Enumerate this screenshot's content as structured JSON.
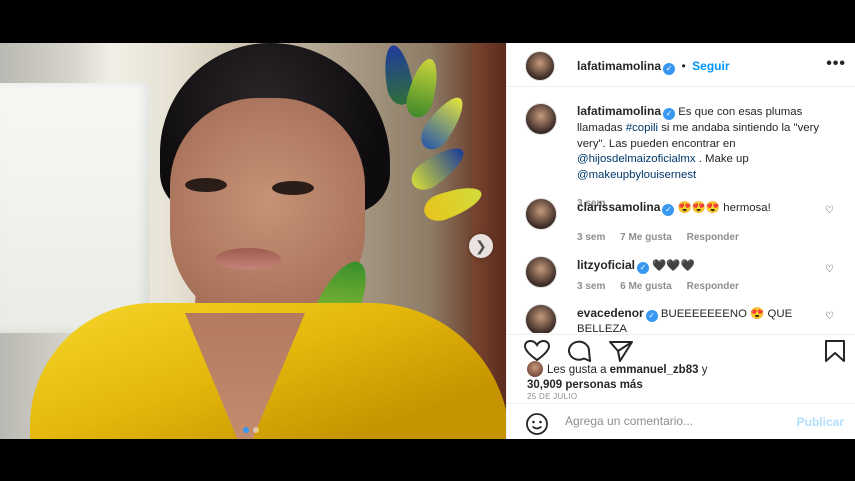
{
  "post": {
    "author": "lafatimamolina",
    "follow_label": "Seguir",
    "more_label": "•••",
    "caption": {
      "username": "lafatimamolina",
      "text_1": "Es que con esas plumas llamadas ",
      "hashtag": "#copili",
      "text_2": " si me andaba sintiendo la \"very very\". Las pueden encontrar en ",
      "mention_1": "@hijosdelmaizoficialmx",
      "text_3": " . Make up ",
      "mention_2": "@makeupbylouisernest",
      "time": "3 sem"
    },
    "comments": [
      {
        "username": "clarissamolina",
        "verified": true,
        "text": "😍😍😍 hermosa!",
        "time": "3 sem",
        "likes": "7 Me gusta",
        "reply": "Responder"
      },
      {
        "username": "litzyoficial",
        "verified": true,
        "text": "🖤🖤🖤",
        "time": "3 sem",
        "likes": "6 Me gusta",
        "reply": "Responder"
      },
      {
        "username": "evacedenor",
        "verified": true,
        "text": "BUEEEEEEENO 😍 QUE BELLEZA",
        "time": "",
        "likes": "",
        "reply": ""
      }
    ],
    "likes_line": {
      "prefix": "Les gusta a ",
      "user": "emmanuel_zb83",
      "middle": " y",
      "count": "30,909 personas más"
    },
    "date": "25 DE JULIO",
    "comment_placeholder": "Agrega un comentario...",
    "publish_label": "Publicar",
    "photo_indicator_count": 2,
    "photo_indicator_active": 1
  },
  "colors": {
    "accent": "#3897f0",
    "follow": "#0095f6",
    "link": "#00376b",
    "publish_disabled": "#b2dffc",
    "dress_yellow": "#f6d72a"
  },
  "icons": [
    "heart-icon",
    "comment-icon",
    "share-icon",
    "bookmark-icon",
    "emoji-icon",
    "next-arrow-icon",
    "verified-icon",
    "more-icon"
  ]
}
